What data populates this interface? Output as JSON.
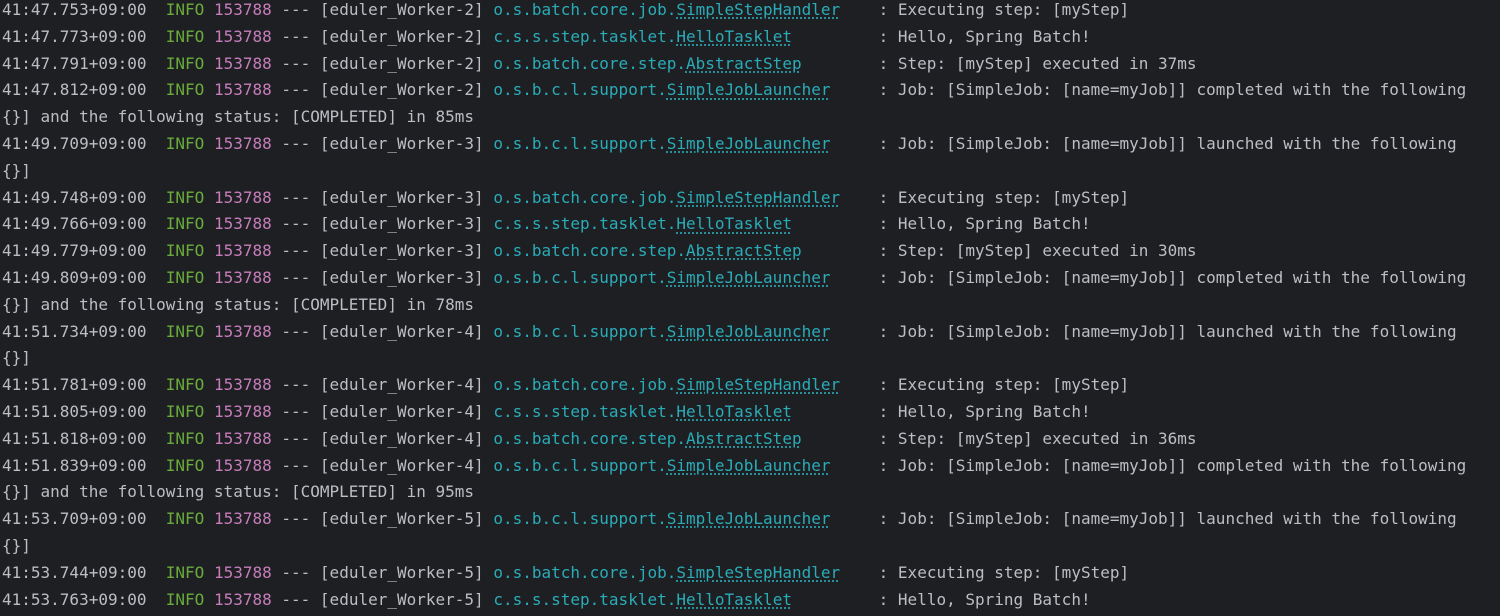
{
  "console": {
    "lines": [
      {
        "kind": "log",
        "ts": "41:47.753+09:00",
        "level": "INFO",
        "pid": "153788",
        "sep": "---",
        "thread": "[eduler_Worker-2]",
        "logger_pkg": "o.s.batch.core.job.",
        "logger_cls": "SimpleStepHandler",
        "message": ": Executing step: [myStep]"
      },
      {
        "kind": "log",
        "ts": "41:47.773+09:00",
        "level": "INFO",
        "pid": "153788",
        "sep": "---",
        "thread": "[eduler_Worker-2]",
        "logger_pkg": "c.s.s.step.tasklet.",
        "logger_cls": "HelloTasklet",
        "message": ": Hello, Spring Batch!"
      },
      {
        "kind": "log",
        "ts": "41:47.791+09:00",
        "level": "INFO",
        "pid": "153788",
        "sep": "---",
        "thread": "[eduler_Worker-2]",
        "logger_pkg": "o.s.batch.core.step.",
        "logger_cls": "AbstractStep",
        "message": ": Step: [myStep] executed in 37ms"
      },
      {
        "kind": "log",
        "ts": "41:47.812+09:00",
        "level": "INFO",
        "pid": "153788",
        "sep": "---",
        "thread": "[eduler_Worker-2]",
        "logger_pkg": "o.s.b.c.l.support.",
        "logger_cls": "SimpleJobLauncher",
        "message": ": Job: [SimpleJob: [name=myJob]] completed with the following"
      },
      {
        "kind": "cont",
        "text": "{}] and the following status: [COMPLETED] in 85ms"
      },
      {
        "kind": "log",
        "ts": "41:49.709+09:00",
        "level": "INFO",
        "pid": "153788",
        "sep": "---",
        "thread": "[eduler_Worker-3]",
        "logger_pkg": "o.s.b.c.l.support.",
        "logger_cls": "SimpleJobLauncher",
        "message": ": Job: [SimpleJob: [name=myJob]] launched with the following"
      },
      {
        "kind": "cont",
        "text": "{}]"
      },
      {
        "kind": "log",
        "ts": "41:49.748+09:00",
        "level": "INFO",
        "pid": "153788",
        "sep": "---",
        "thread": "[eduler_Worker-3]",
        "logger_pkg": "o.s.batch.core.job.",
        "logger_cls": "SimpleStepHandler",
        "message": ": Executing step: [myStep]"
      },
      {
        "kind": "log",
        "ts": "41:49.766+09:00",
        "level": "INFO",
        "pid": "153788",
        "sep": "---",
        "thread": "[eduler_Worker-3]",
        "logger_pkg": "c.s.s.step.tasklet.",
        "logger_cls": "HelloTasklet",
        "message": ": Hello, Spring Batch!"
      },
      {
        "kind": "log",
        "ts": "41:49.779+09:00",
        "level": "INFO",
        "pid": "153788",
        "sep": "---",
        "thread": "[eduler_Worker-3]",
        "logger_pkg": "o.s.batch.core.step.",
        "logger_cls": "AbstractStep",
        "message": ": Step: [myStep] executed in 30ms"
      },
      {
        "kind": "log",
        "ts": "41:49.809+09:00",
        "level": "INFO",
        "pid": "153788",
        "sep": "---",
        "thread": "[eduler_Worker-3]",
        "logger_pkg": "o.s.b.c.l.support.",
        "logger_cls": "SimpleJobLauncher",
        "message": ": Job: [SimpleJob: [name=myJob]] completed with the following"
      },
      {
        "kind": "cont",
        "text": "{}] and the following status: [COMPLETED] in 78ms"
      },
      {
        "kind": "log",
        "ts": "41:51.734+09:00",
        "level": "INFO",
        "pid": "153788",
        "sep": "---",
        "thread": "[eduler_Worker-4]",
        "logger_pkg": "o.s.b.c.l.support.",
        "logger_cls": "SimpleJobLauncher",
        "message": ": Job: [SimpleJob: [name=myJob]] launched with the following"
      },
      {
        "kind": "cont",
        "text": "{}]"
      },
      {
        "kind": "log",
        "ts": "41:51.781+09:00",
        "level": "INFO",
        "pid": "153788",
        "sep": "---",
        "thread": "[eduler_Worker-4]",
        "logger_pkg": "o.s.batch.core.job.",
        "logger_cls": "SimpleStepHandler",
        "message": ": Executing step: [myStep]"
      },
      {
        "kind": "log",
        "ts": "41:51.805+09:00",
        "level": "INFO",
        "pid": "153788",
        "sep": "---",
        "thread": "[eduler_Worker-4]",
        "logger_pkg": "c.s.s.step.tasklet.",
        "logger_cls": "HelloTasklet",
        "message": ": Hello, Spring Batch!"
      },
      {
        "kind": "log",
        "ts": "41:51.818+09:00",
        "level": "INFO",
        "pid": "153788",
        "sep": "---",
        "thread": "[eduler_Worker-4]",
        "logger_pkg": "o.s.batch.core.step.",
        "logger_cls": "AbstractStep",
        "message": ": Step: [myStep] executed in 36ms"
      },
      {
        "kind": "log",
        "ts": "41:51.839+09:00",
        "level": "INFO",
        "pid": "153788",
        "sep": "---",
        "thread": "[eduler_Worker-4]",
        "logger_pkg": "o.s.b.c.l.support.",
        "logger_cls": "SimpleJobLauncher",
        "message": ": Job: [SimpleJob: [name=myJob]] completed with the following"
      },
      {
        "kind": "cont",
        "text": "{}] and the following status: [COMPLETED] in 95ms"
      },
      {
        "kind": "log",
        "ts": "41:53.709+09:00",
        "level": "INFO",
        "pid": "153788",
        "sep": "---",
        "thread": "[eduler_Worker-5]",
        "logger_pkg": "o.s.b.c.l.support.",
        "logger_cls": "SimpleJobLauncher",
        "message": ": Job: [SimpleJob: [name=myJob]] launched with the following"
      },
      {
        "kind": "cont",
        "text": "{}]"
      },
      {
        "kind": "log",
        "ts": "41:53.744+09:00",
        "level": "INFO",
        "pid": "153788",
        "sep": "---",
        "thread": "[eduler_Worker-5]",
        "logger_pkg": "o.s.batch.core.job.",
        "logger_cls": "SimpleStepHandler",
        "message": ": Executing step: [myStep]"
      },
      {
        "kind": "log",
        "ts": "41:53.763+09:00",
        "level": "INFO",
        "pid": "153788",
        "sep": "---",
        "thread": "[eduler_Worker-5]",
        "logger_pkg": "c.s.s.step.tasklet.",
        "logger_cls": "HelloTasklet",
        "message": ": Hello, Spring Batch!"
      }
    ]
  },
  "colors": {
    "background": "#1e1f22",
    "text": "#bcbec4",
    "info_level": "#6aab3b",
    "pid": "#c77dbb",
    "logger": "#2aacb8"
  }
}
